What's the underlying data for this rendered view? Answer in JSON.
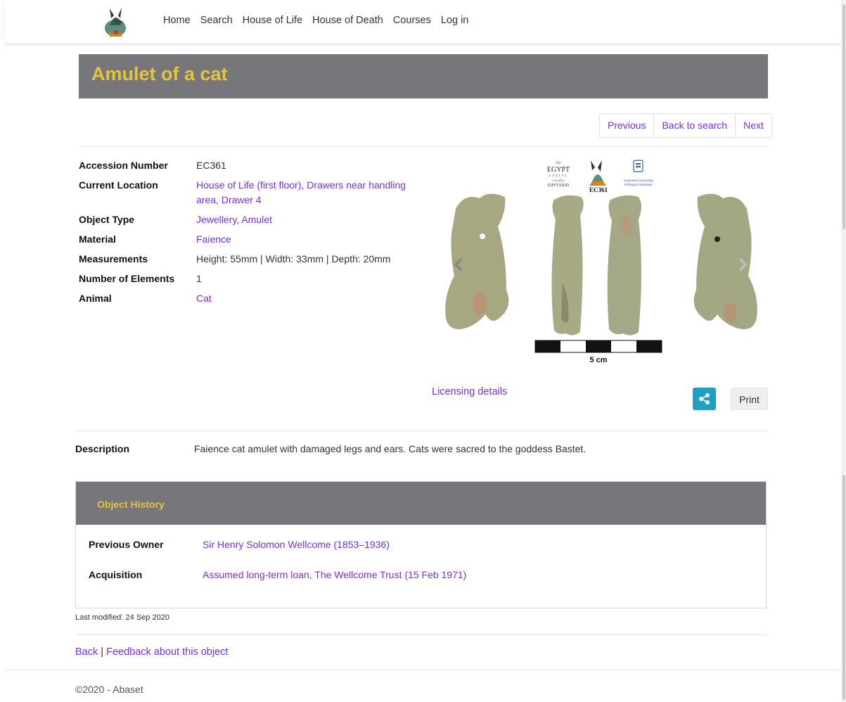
{
  "nav": {
    "links": [
      "Home",
      "Search",
      "House of Life",
      "House of Death",
      "Courses",
      "Log in"
    ]
  },
  "page": {
    "title": "Amulet of a cat"
  },
  "pager": {
    "previous": "Previous",
    "back": "Back to search",
    "next": "Next"
  },
  "details": [
    {
      "label": "Accession Number",
      "value": "EC361",
      "link": false
    },
    {
      "label": "Current Location",
      "value": "House of Life (first floor), Drawers near handling area, Drawer 4",
      "link": true
    },
    {
      "label": "Object Type",
      "value": "Jewellery, Amulet",
      "link": true
    },
    {
      "label": "Material",
      "value": "Faience",
      "link": true
    },
    {
      "label": "Measurements",
      "value": "Height: 55mm | Width: 33mm | Depth: 20mm",
      "link": false
    },
    {
      "label": "Number of Elements",
      "value": "1",
      "link": false
    },
    {
      "label": "Animal",
      "value": "Cat",
      "link": true
    }
  ],
  "image": {
    "egypt_centre_text_top": "the",
    "egypt_centre_text": "EGYPT",
    "egypt_centre_text2": "centre",
    "egypt_centre_text3": "canolfan",
    "egypt_centre_text4": "EIFFTAIDD",
    "accession_label": "EC361",
    "university_text": "Swansea University",
    "university_text2": "Prifysgol Abertawe",
    "scale_label": "5 cm",
    "licensing": "Licensing details"
  },
  "actions": {
    "print": "Print"
  },
  "description": {
    "label": "Description",
    "text": "Faience cat amulet with damaged legs and ears. Cats were sacred to the goddess Bastet."
  },
  "history": {
    "title": "Object History",
    "previous_owner_label": "Previous Owner",
    "previous_owner": "Sir Henry Solomon Wellcome (1853–1936)",
    "acquisition_label": "Acquisition",
    "acquisition": "Assumed long-term loan, The Wellcome Trust (15 Feb 1971)"
  },
  "footer": {
    "last_modified": "Last modified: 24 Sep 2020",
    "back": "Back",
    "separator": "|",
    "feedback": "Feedback about this object",
    "copyright": "©2020 - Abaset"
  },
  "colors": {
    "title_bar": "#76767b",
    "title_text": "#e3c53c",
    "link": "#7b2fe0",
    "share": "#1e9fc4"
  }
}
